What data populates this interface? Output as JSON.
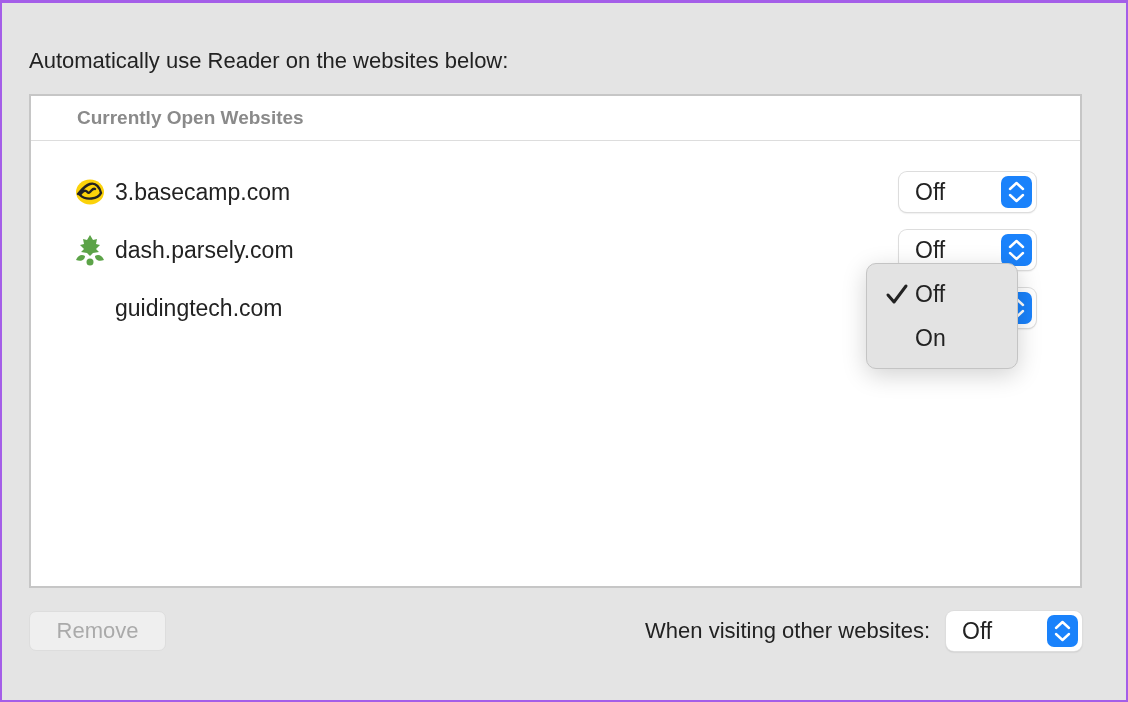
{
  "heading": "Automatically use Reader on the websites below:",
  "list": {
    "header": "Currently Open Websites",
    "rows": [
      {
        "site": "3.basecamp.com",
        "kind": "badge",
        "value": "Off"
      },
      {
        "site": "dash.parsely.com",
        "kind": "leaf",
        "value": "Off"
      },
      {
        "site": "guidingtech.com",
        "kind": "plain",
        "menu": [
          {
            "label": "Off",
            "selected": true
          },
          {
            "label": "On",
            "selected": false
          }
        ]
      }
    ]
  },
  "footer": {
    "remove": {
      "label": "Remove",
      "disabled": true
    },
    "other_label": "When visiting other websites:",
    "other_value": "Off"
  }
}
